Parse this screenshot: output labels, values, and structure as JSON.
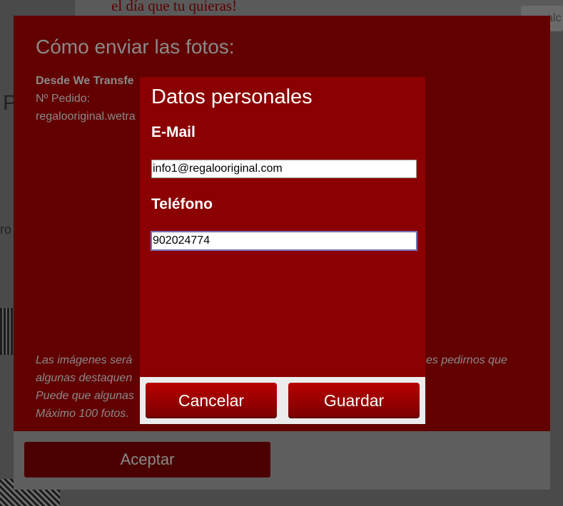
{
  "background": {
    "banner_text": "el día que tu quieras!",
    "search_text": "alc",
    "side_letter": "P",
    "side_text": "ro"
  },
  "outer_dialog": {
    "title": "Cómo enviar las fotos:",
    "section_heading": "Desde We Transfe",
    "order_label": "Nº Pedido:",
    "address": "regalooriginal.wetra",
    "notes": [
      "Las imágenes será",
      "algunas destaquen",
      "Puede que algunas",
      "Máximo 100 fotos."
    ],
    "notes_right": "es pedirnos que",
    "accept_label": "Aceptar"
  },
  "inner_dialog": {
    "title": "Datos personales",
    "email": {
      "label": "E-Mail",
      "value": "info1@regalooriginal.com"
    },
    "phone": {
      "label": "Teléfono",
      "value": "902024774"
    },
    "cancel_label": "Cancelar",
    "save_label": "Guardar"
  },
  "colors": {
    "inner_dialog_bg": "#8b0000",
    "outer_dialog_bg": "#620000",
    "button_gradient_top": "#b80000",
    "button_gradient_bottom": "#7a0000"
  }
}
